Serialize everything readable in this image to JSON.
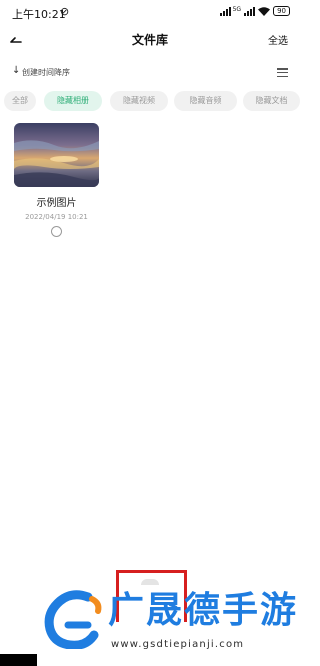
{
  "status_bar": {
    "time": "上午10:21",
    "battery": "90",
    "signal_label": "5G"
  },
  "header": {
    "title": "文件库",
    "select_all": "全选"
  },
  "sort": {
    "label": "创建时间降序"
  },
  "tabs": [
    {
      "label": "全部",
      "active": false
    },
    {
      "label": "隐藏相册",
      "active": true
    },
    {
      "label": "隐藏视频",
      "active": false
    },
    {
      "label": "隐藏音频",
      "active": false
    },
    {
      "label": "隐藏文档",
      "active": false
    }
  ],
  "files": [
    {
      "name": "示例图片",
      "date": "2022/04/19 10:21",
      "selected": false
    }
  ],
  "watermark": {
    "brand": "广晟德手游",
    "url": "www.gsdtiepianji.com"
  },
  "colors": {
    "accent_green": "#2fae78",
    "active_tab_bg": "#e2f5ed",
    "highlight_red": "#d61f1f",
    "watermark_blue": "#1f7de0"
  }
}
